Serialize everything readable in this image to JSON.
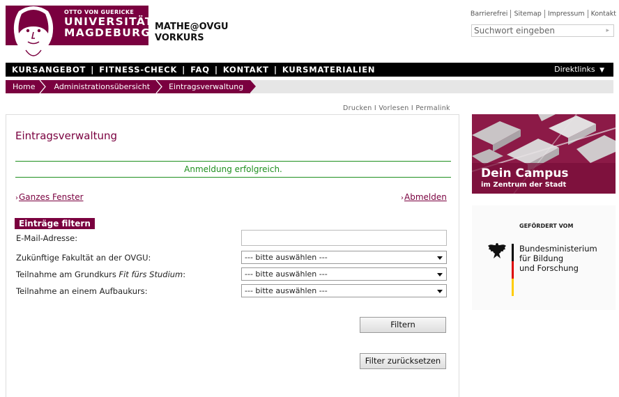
{
  "logo": {
    "line1": "OTTO VON GUERICKE",
    "line2": "UNIVERSITÄT",
    "line3": "MAGDEBURG"
  },
  "site": {
    "name_line1": "MATHE@OVGU",
    "name_line2": "VORKURS"
  },
  "utility_links": [
    "Barrierefrei",
    "Sitemap",
    "Impressum",
    "Kontakt"
  ],
  "search": {
    "placeholder": "Suchwort eingeben"
  },
  "main_nav": {
    "items": [
      "KURSANGEBOT",
      "FITNESS-CHECK",
      "FAQ",
      "KONTAKT",
      "KURSMATERIALIEN"
    ],
    "separator": "|",
    "direct_links": "Direktlinks"
  },
  "breadcrumb": [
    "Home",
    "Administrationsübersicht",
    "Eintragsverwaltung"
  ],
  "tool_links": {
    "print": "Drucken",
    "read": "Vorlesen",
    "permalink": "Permalink",
    "separator": "I"
  },
  "content": {
    "title": "Eintragsverwaltung",
    "success_message": "Anmeldung erfolgreich.",
    "link_full_window": "Ganzes Fenster",
    "link_logout": "Abmelden",
    "link_chevron": "›"
  },
  "filter": {
    "heading": "Einträge filtern",
    "email_label": "E-Mail-Adresse:",
    "email_value": "",
    "faculty_label": "Zukünftige Fakultät an der OVGU:",
    "basic_course_label_prefix": "Teilnahme am Grundkurs ",
    "basic_course_label_italic": "Fit fürs Studium",
    "basic_course_label_suffix": ":",
    "advanced_course_label": "Teilnahme an einem Aufbaukurs:",
    "select_default": "--- bitte auswählen ---",
    "filter_button": "Filtern",
    "reset_button": "Filter zurücksetzen"
  },
  "campus_banner": {
    "title": "Dein Campus",
    "subtitle": "im Zentrum der Stadt"
  },
  "funding": {
    "funded_by": "GEFÖRDERT VOM",
    "ministry_line1": "Bundesministerium",
    "ministry_line2": "für Bildung",
    "ministry_line3": "und Forschung"
  },
  "colors": {
    "brand": "#7a003f",
    "success": "#1e8f1e",
    "nav_bg": "#000000"
  }
}
